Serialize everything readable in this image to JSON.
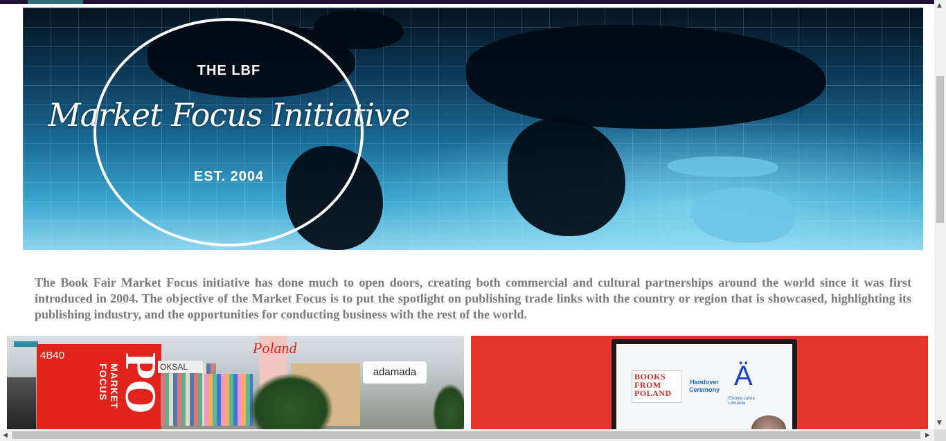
{
  "banner": {
    "title_top": "THE LBF",
    "title_main": "Market Focus Initiative",
    "title_bottom": "EST. 2004"
  },
  "description": "The Book Fair Market Focus initiative has done much to open doors, creating both commercial and cultural partnerships around the world since it was first introduced in 2004. The objective of the Market Focus is to put the spotlight on publishing trade links with the country or region that is showcased, highlighting its publishing industry, and the opportunities for conducting business with the rest of the world.",
  "photo_left": {
    "stand_number": "4B40",
    "market_focus": "MARKET FOCUS",
    "big_letters": "PO",
    "oksal": "OKSAL",
    "poland_sign": "Poland",
    "adamada": "adamada"
  },
  "photo_right": {
    "books_from_poland": "BOOKS FROM POLAND",
    "handover": "Handover Ceremony",
    "a_letter": "Ä",
    "baltics": "Estonia Latvia Lithuania"
  },
  "colors": {
    "topbar": "#1f1138",
    "description_text": "#7a7a7a",
    "booth_red": "#e0241b",
    "backdrop_red": "#e3342c"
  },
  "scrollbar": {
    "up_arrow": "▲",
    "down_arrow": "▼",
    "left_arrow": "◀",
    "right_arrow": "▶"
  }
}
